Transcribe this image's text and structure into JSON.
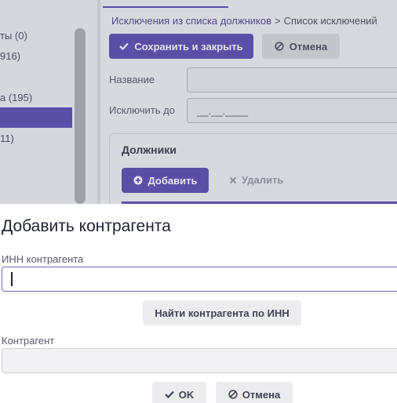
{
  "background": {
    "left_items": [
      {
        "text": "ты (0)"
      },
      {
        "text": "916)"
      },
      {
        "text": "а (195)"
      },
      {
        "text": "11)"
      }
    ],
    "breadcrumb": {
      "link": "Исключения из списка должников",
      "separator": ">",
      "current": "Список исключений"
    },
    "toolbar": {
      "save_label": "Сохранить и закрыть",
      "cancel_label": "Отмена"
    },
    "fields": {
      "name_label": "Название",
      "exclude_until_label": "Исключить до",
      "exclude_until_value": "__.__.____"
    },
    "debtors": {
      "title": "Должники",
      "add_label": "Добавить",
      "delete_label": "Удалить"
    }
  },
  "dialog": {
    "title": "Добавить контрагента",
    "inn_label": "ИНН контрагента",
    "inn_value": "",
    "find_button": "Найти контрагента по ИНН",
    "contractor_label": "Контрагент",
    "contractor_value": "",
    "ok_label": "OK",
    "cancel_label": "Отмена"
  },
  "icons": {
    "save": "check-icon",
    "cancel": "cancel-circle-icon",
    "add": "plus-circle-icon",
    "delete": "x-icon",
    "ok": "check-icon"
  },
  "colors": {
    "accent": "#5b4ea6",
    "dim_background": "#d8d9df",
    "dialog_background": "#ffffff"
  }
}
